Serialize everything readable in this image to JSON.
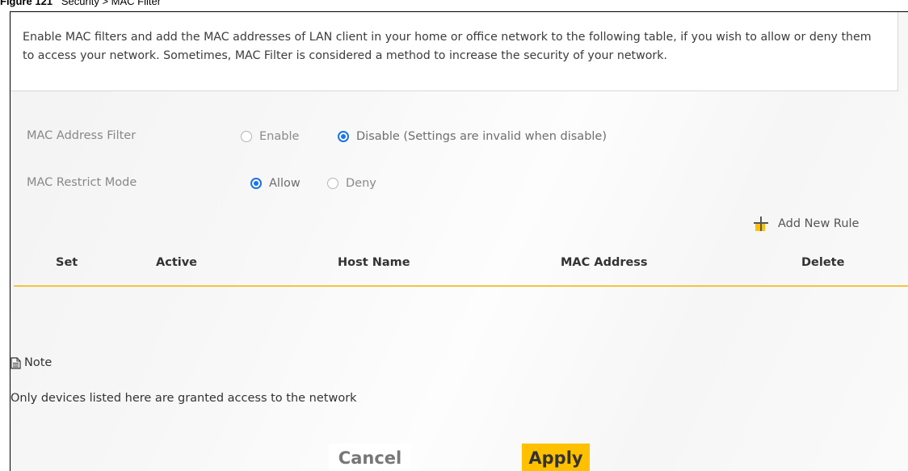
{
  "caption": {
    "figure": "Figure 121",
    "title": "Security > MAC Filter"
  },
  "intro": "Enable MAC filters and add the MAC addresses of LAN client in your home or office network to the following table, if you wish to allow or deny them to access your network. Sometimes, MAC Filter is considered a method to increase the security of your network.",
  "mac_filter": {
    "label": "MAC Address Filter",
    "options": [
      "Enable",
      "Disable (Settings are invalid when disable)"
    ],
    "selected": "Disable (Settings are invalid when disable)"
  },
  "restrict_mode": {
    "label": "MAC Restrict Mode",
    "options": [
      "Allow",
      "Deny"
    ],
    "selected": "Allow"
  },
  "add_rule_label": "Add New Rule",
  "table": {
    "columns": [
      "Set",
      "Active",
      "Host Name",
      "MAC Address",
      "Delete"
    ],
    "rows": []
  },
  "note": {
    "label": "Note",
    "text": "Only devices listed here are granted access to the network"
  },
  "buttons": {
    "cancel": "Cancel",
    "apply": "Apply"
  },
  "colors": {
    "accent": "#ffc000",
    "radio_selected": "#1a73e8",
    "header_line": "#f5c242"
  }
}
